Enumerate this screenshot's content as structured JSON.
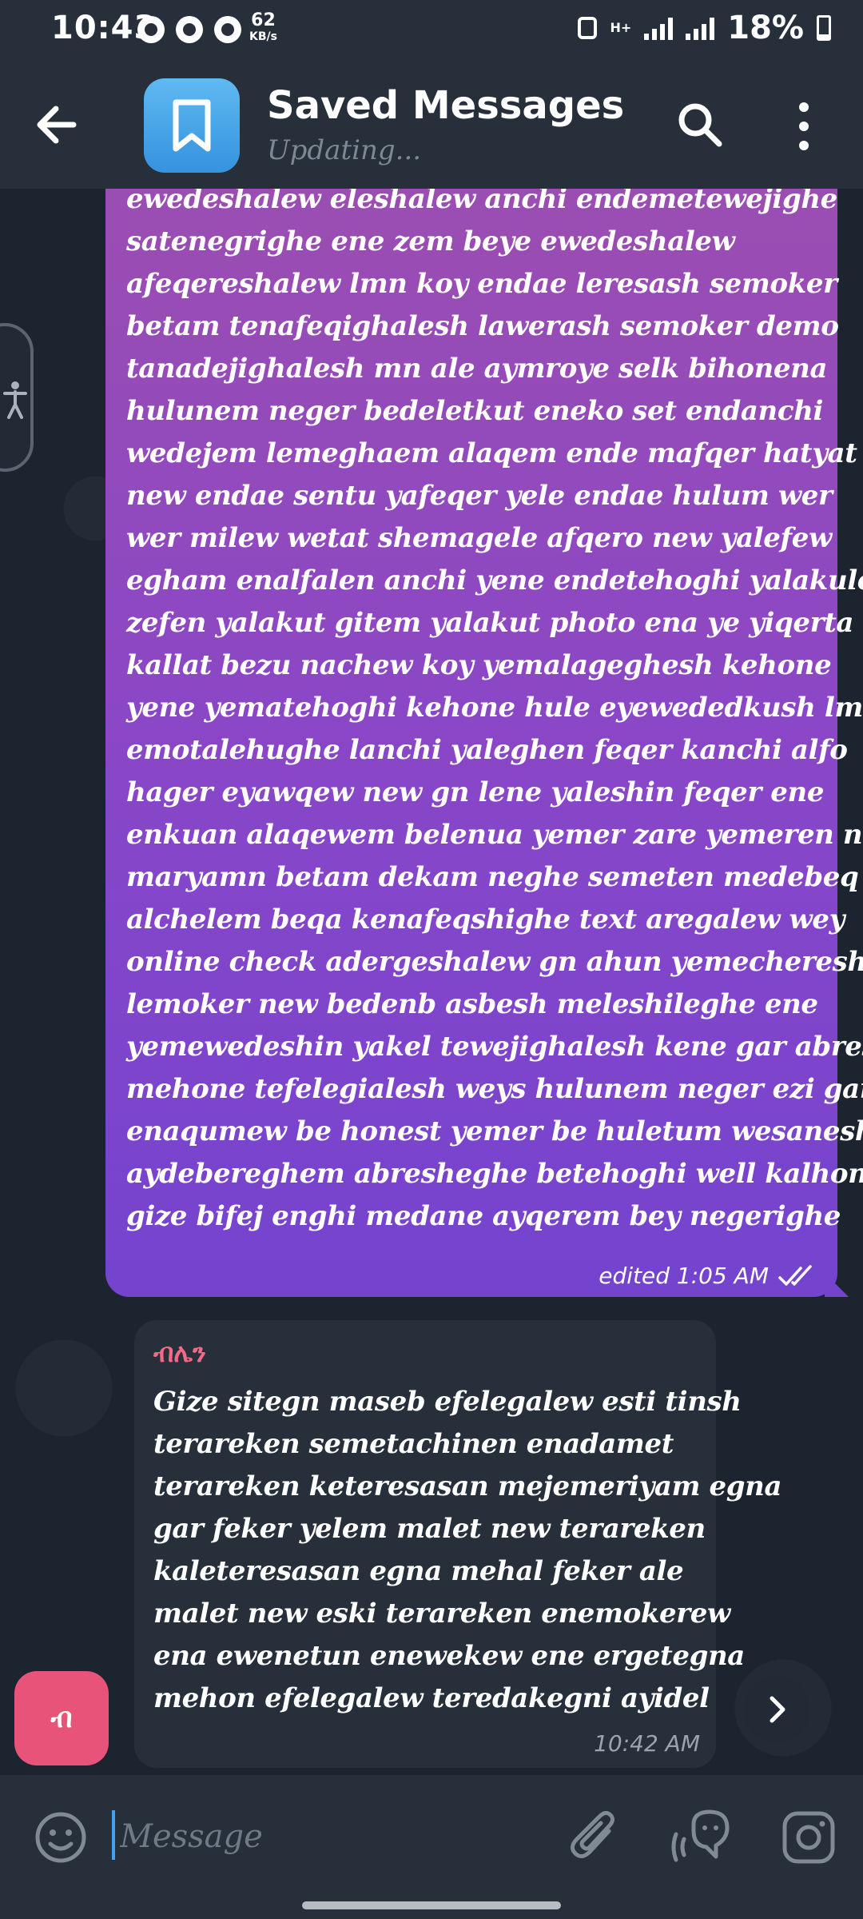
{
  "status_bar": {
    "time": "10:43",
    "net_speed_value": "62",
    "net_speed_unit": "KB/s",
    "network_type": "H+",
    "battery": "18%"
  },
  "header": {
    "title": "Saved Messages",
    "subtitle": "Updating..."
  },
  "messages": {
    "outgoing": {
      "text_lines": [
        "ewedeshalew eleshalew anchi endemetewejighe",
        "satenegrighe ene zem beye ewedeshalew",
        "afeqereshalew lmn koy endae leresash semoker",
        "betam tenafeqighalesh lawerash semoker demo",
        "tanadejighalesh mn ale aymroye selk bihonena",
        "hulunem neger bedeletkut eneko set endanchi",
        "wedejem lemeghaem alaqem ende mafqer hatyat",
        "new endae sentu yafeqer yele endae hulum wer",
        "wer milew wetat shemagele afqero new yalefew",
        "egham enalfalen anchi yene endetehoghi yalakulesh",
        "zefen yalakut gitem yalakut photo ena ye yiqerta",
        "kallat bezu nachew koy yemalageghesh kehone",
        "yene yematehoghi kehone hule eyewededkush lmn",
        "emotalehughe lanchi yaleghen feqer kanchi alfo",
        "hager eyawqew new gn lene yaleshin feqer ene",
        "enkuan alaqewem belenua yemer zare yemeren new",
        "maryamn betam dekam neghe semeten medebeq",
        "alchelem beqa kenafeqshighe text aregalew wey",
        "online check adergeshalew gn ahun yemecheresha",
        "lemoker new bedenb asbesh meleshileghe ene",
        "yemewedeshin yakel tewejighalesh kene gar abresh",
        "mehone tefelegialesh weys hulunem neger ezi gar",
        "enaqumew be honest yemer be huletum wesanesh",
        "aydebereghem abresheghe betehoghi well kalhonem",
        "gize bifej enghi medane ayqerem bey negerighe"
      ],
      "meta": "edited 1:05 AM"
    },
    "incoming": {
      "sender": "ብሌን",
      "text_lines": [
        "Gize sitegn maseb efelegalew esti tinsh",
        "terareken semetachinen enadamet",
        "terareken keteresasan mejemeriyam egna",
        "gar feker yelem malet new terareken",
        "kaleteresasan egna mehal feker ale",
        "malet new eski terareken enemokerew",
        "ena ewenetun enewekew ene ergetegna",
        "mehon efelegalew teredakegni ayidel"
      ],
      "time": "10:42 AM",
      "avatar_letter": "ብ"
    }
  },
  "input": {
    "placeholder": "Message"
  },
  "colors": {
    "header_bg": "#262f3a",
    "chat_bg": "#1b242f",
    "outgoing_bubble_top": "#9c4eb0",
    "outgoing_bubble_bottom": "#7444cf",
    "incoming_bubble": "#262f3a",
    "sender_name": "#f26a86",
    "avatar_blue": "#4aa6ea",
    "sender_avatar": "#e85479"
  },
  "icons": {
    "back": "arrow-left-icon",
    "avatar": "bookmark-icon",
    "search": "search-icon",
    "more": "more-vertical-icon",
    "accessibility": "accessibility-icon",
    "read_status": "double-check-icon",
    "forward": "chevron-right-icon",
    "emoji": "smile-icon",
    "attach": "paperclip-icon",
    "voice": "voice-chat-icon",
    "camera": "instagram-camera-icon"
  }
}
